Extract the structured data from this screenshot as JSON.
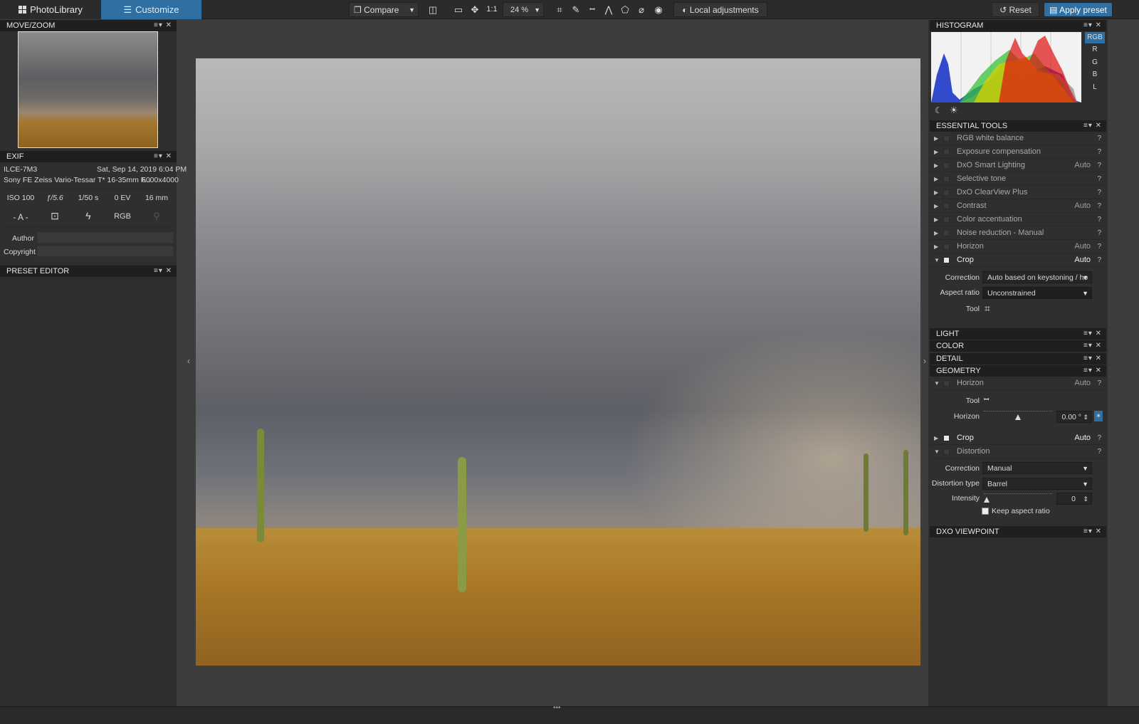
{
  "tabs": {
    "library": "PhotoLibrary",
    "customize": "Customize"
  },
  "toolbar": {
    "compare": "Compare",
    "ratio": "1:1",
    "zoom": "24 %",
    "local_adjustments": "Local adjustments",
    "reset": "Reset",
    "apply_preset": "Apply preset"
  },
  "left": {
    "movezoom_title": "MOVE/ZOOM",
    "exif_title": "EXIF",
    "camera": "ILCE-7M3",
    "date": "Sat, Sep 14, 2019 6:04 PM",
    "lens": "Sony FE Zeiss Vario-Tessar T* 16-35mm F...",
    "resolution": "6000x4000",
    "iso": "ISO 100",
    "aperture": "ƒ/5.6",
    "shutter": "1/50 s",
    "ev": "0 EV",
    "focal": "16 mm",
    "mode": "- A -",
    "colorspace": "RGB",
    "author_label": "Author",
    "copyright_label": "Copyright",
    "preset_title": "PRESET EDITOR"
  },
  "right": {
    "histogram_title": "HISTOGRAM",
    "channels": [
      "RGB",
      "R",
      "G",
      "B",
      "L"
    ],
    "essential_title": "ESSENTIAL TOOLS",
    "essential": [
      {
        "label": "RGB white balance",
        "auto": ""
      },
      {
        "label": "Exposure compensation",
        "auto": ""
      },
      {
        "label": "DxO Smart Lighting",
        "auto": "Auto"
      },
      {
        "label": "Selective tone",
        "auto": ""
      },
      {
        "label": "DxO ClearView Plus",
        "auto": ""
      },
      {
        "label": "Contrast",
        "auto": "Auto"
      },
      {
        "label": "Color accentuation",
        "auto": ""
      },
      {
        "label": "Noise reduction - Manual",
        "auto": ""
      },
      {
        "label": "Horizon",
        "auto": "Auto"
      },
      {
        "label": "Crop",
        "auto": "Auto"
      }
    ],
    "crop_correction_label": "Correction",
    "crop_correction_value": "Auto based on keystoning / ho",
    "aspect_label": "Aspect ratio",
    "aspect_value": "Unconstrained",
    "tool_label": "Tool",
    "light_title": "LIGHT",
    "color_title": "COLOR",
    "detail_title": "DETAIL",
    "geometry_title": "GEOMETRY",
    "geo_horizon": "Horizon",
    "geo_horizon_auto": "Auto",
    "geo_tool_label": "Tool",
    "geo_horizon_label": "Horizon",
    "geo_horizon_value": "0.00 °",
    "geo_crop": "Crop",
    "geo_crop_auto": "Auto",
    "geo_distortion": "Distortion",
    "dist_correction_label": "Correction",
    "dist_correction_value": "Manual",
    "dist_type_label": "Distortion type",
    "dist_type_value": "Barrel",
    "intensity_label": "Intensity",
    "intensity_value": "0",
    "keep_aspect": "Keep aspect ratio",
    "viewpoint_title": "DXO VIEWPOINT"
  }
}
